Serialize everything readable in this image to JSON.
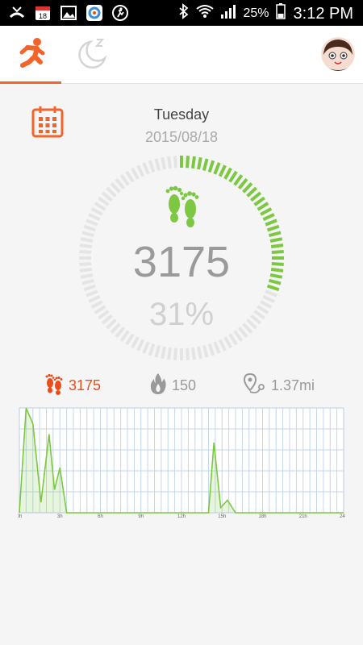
{
  "status_bar": {
    "battery_percent": "25%",
    "time": "3:12 PM",
    "calendar_day": "18"
  },
  "tabs": [
    {
      "name": "activity",
      "icon": "running-person-icon",
      "selected": true
    },
    {
      "name": "sleep",
      "icon": "moon-icon",
      "selected": false
    }
  ],
  "summary": {
    "day": "Tuesday",
    "date": "2015/08/18",
    "steps": "3175",
    "percent": "31%",
    "progress": 0.31,
    "calories": "150",
    "distance": "1.37mi"
  },
  "colors": {
    "accent": "#f2642a",
    "steps_red": "#e94e1b",
    "progress_green": "#7dc842",
    "ring_gray": "#e4e4e4"
  },
  "chart_data": {
    "type": "area",
    "x_tick_labels": [
      "0h",
      "3h",
      "6h",
      "9h",
      "12h",
      "15h",
      "18h",
      "21h",
      "24h"
    ],
    "xlim": [
      0,
      24
    ],
    "ylim": [
      0,
      100
    ],
    "grid": true,
    "series": [
      {
        "x": [
          0,
          0.5,
          1,
          1.6,
          2.2,
          2.6,
          3,
          3.5,
          4,
          14,
          14.4,
          14.9,
          15.4,
          16,
          24
        ],
        "values": [
          0,
          100,
          85,
          10,
          75,
          22,
          43,
          0,
          0,
          0,
          67,
          5,
          12,
          0,
          0
        ]
      }
    ]
  }
}
